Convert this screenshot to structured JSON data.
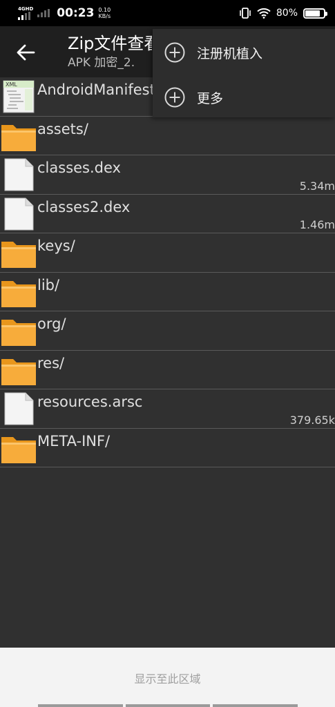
{
  "status_bar": {
    "network_type": "4GHD",
    "time": "00:23",
    "speed_value": "0.10",
    "speed_unit": "KB/s",
    "battery": "80%",
    "battery_level": 0.8
  },
  "toolbar": {
    "title": "Zip文件查看",
    "subtitle": "APK 加密_2.",
    "back_icon": "arrow-left-icon"
  },
  "files": [
    {
      "name": "AndroidManifest.xml",
      "type": "xml",
      "size": ""
    },
    {
      "name": "assets/",
      "type": "folder",
      "size": ""
    },
    {
      "name": "classes.dex",
      "type": "file",
      "size": "5.34m"
    },
    {
      "name": "classes2.dex",
      "type": "file",
      "size": "1.46m"
    },
    {
      "name": "keys/",
      "type": "folder",
      "size": ""
    },
    {
      "name": "lib/",
      "type": "folder",
      "size": ""
    },
    {
      "name": "org/",
      "type": "folder",
      "size": ""
    },
    {
      "name": "res/",
      "type": "folder",
      "size": ""
    },
    {
      "name": "resources.arsc",
      "type": "file",
      "size": "379.65k"
    },
    {
      "name": "META-INF/",
      "type": "folder",
      "size": ""
    }
  ],
  "menu": {
    "items": [
      {
        "label": "注册机植入",
        "icon": "plus-circle-icon"
      },
      {
        "label": "更多",
        "icon": "plus-circle-icon"
      }
    ]
  },
  "bottom": {
    "hint": "显示至此区域"
  },
  "colors": {
    "background": "#303030",
    "toolbar": "#1f1f1f",
    "folder": "#f5a623",
    "divider": "#5a5a5a"
  }
}
